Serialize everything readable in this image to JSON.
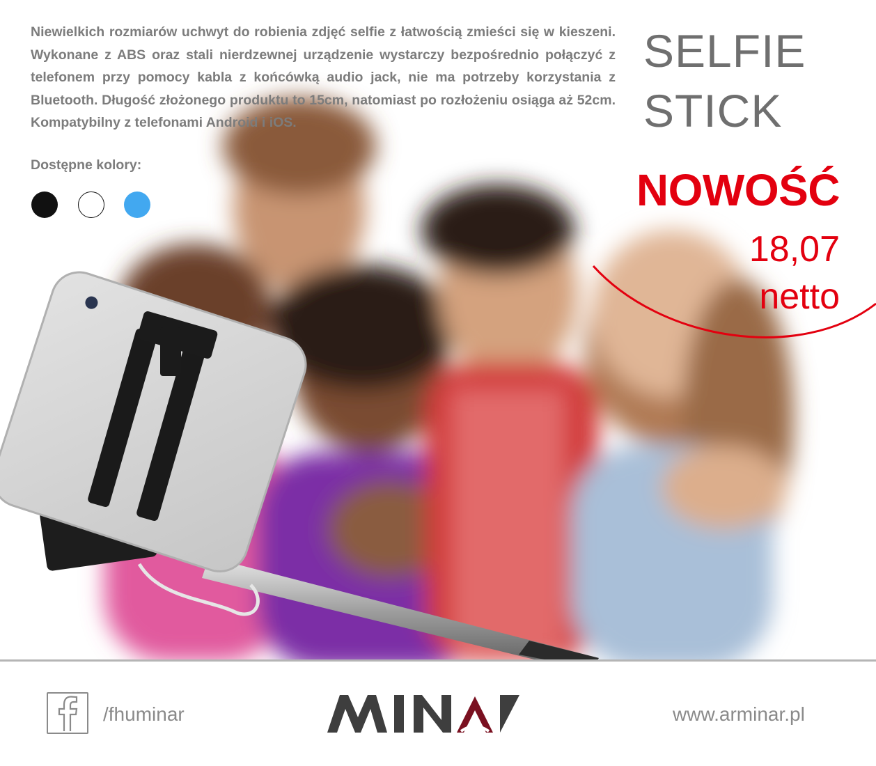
{
  "product": {
    "description": "Niewielkich rozmiarów uchwyt do robienia zdjęć selfie z łatwością zmieści się w kieszeni. Wykonane z ABS oraz stali nierdzewnej urządzenie wystarczy bezpośrednio połączyć z telefonem przy pomocy kabla z końcówką audio jack, nie ma potrzeby korzystania z Bluetooth. Długość złożonego produktu to 15cm, natomiast po rozłożeniu osiąga aż 52cm. Kompatybilny z telefonami Android i iOS.",
    "title_line1": "SELFIE",
    "title_line2": "STICK",
    "colors_label": "Dostępne kolory:",
    "colors": [
      "#111111",
      "#ffffff",
      "#42a8f0"
    ]
  },
  "promo": {
    "badge": "NOWOŚĆ",
    "price": "18,07",
    "price_note": "netto",
    "accent_color": "#e3000f"
  },
  "footer": {
    "facebook_handle": "/fhuminar",
    "website": "www.arminar.pl",
    "logo_text": "MINAR",
    "facebook_icon": "facebook-icon"
  }
}
